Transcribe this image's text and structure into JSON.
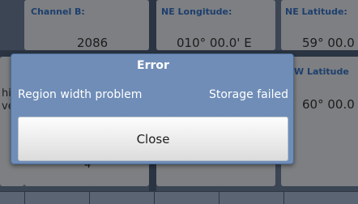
{
  "background": {
    "channel_b": {
      "label": "Channel B:",
      "value": "2086"
    },
    "ne_longitude": {
      "label": "NE Longitude:",
      "value": "010° 00.0' E"
    },
    "ne_latitude": {
      "label": "NE Latitude:",
      "value": "59° 00.0"
    },
    "w_latitude": {
      "label": "W Latitude",
      "value": "60° 00.0"
    },
    "left_fragment_1": "hi",
    "left_fragment_2": "ve",
    "lower_fragment": "4"
  },
  "dialog": {
    "title": "Error",
    "message_left": "Region width problem",
    "message_right": "Storage failed",
    "close_label": "Close"
  },
  "colors": {
    "dialog_background": "#6f8db7",
    "label_color": "#1d3f6e"
  }
}
